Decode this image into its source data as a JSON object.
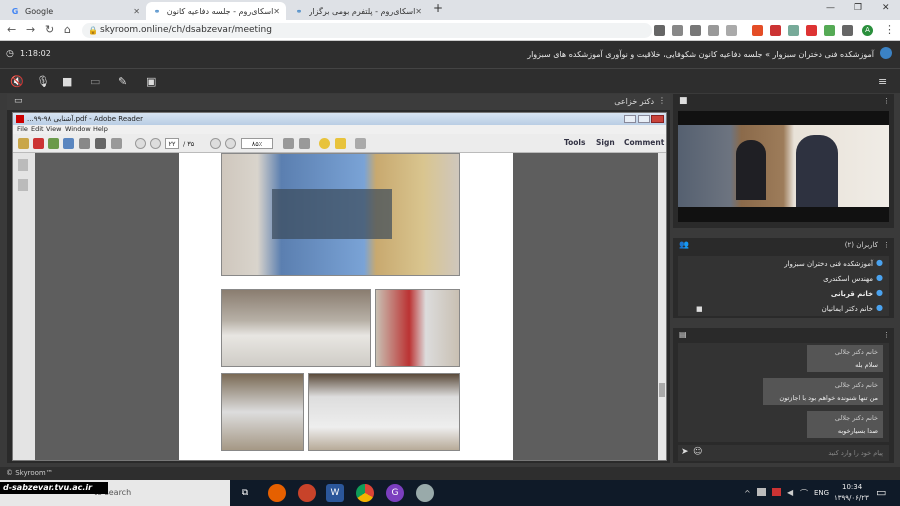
{
  "browser": {
    "tabs": [
      {
        "title": "Google",
        "active": false
      },
      {
        "title": "اسکای‌روم - جلسه دفاعیه کانون ش…",
        "active": true
      },
      {
        "title": "اسکای‌روم - پلتفرم بومی برگزاری و…",
        "active": false
      }
    ],
    "new_tab": "+",
    "url": "skyroom.online/ch/dsabzevar/meeting",
    "profile_initial": "A"
  },
  "app": {
    "timer": "1:18:02",
    "title": "آموزشکده فنی دختران سبزوار » جلسه دفاعیه کانون شکوفایی، خلاقیت و نوآوری آموزشکده های سبزوار",
    "presenter": "دکتر خزاعی"
  },
  "reader": {
    "title": "...آشنایی ۹۸-۹۹.pdf - Adobe Reader",
    "menu": [
      "File",
      "Edit",
      "View",
      "Window",
      "Help"
    ],
    "page_num": "۲۲",
    "page_sep": "/ ۳۵",
    "zoom": "۸۵٪",
    "right_tools": [
      "Tools",
      "Sign",
      "Comment"
    ]
  },
  "users": {
    "header": "کاربران (۲)",
    "list": [
      {
        "name": "آموزشکده فنی دختران سبزوار",
        "bold": false
      },
      {
        "name": "مهندس اسکندری",
        "bold": false
      },
      {
        "name": "خانم قربانی",
        "bold": true
      },
      {
        "name": "خانم دکتر ایمانیان",
        "bold": false
      }
    ]
  },
  "chat": {
    "messages": [
      {
        "sender": "خانم دکتر جلالی",
        "text": "سلام بله"
      },
      {
        "sender": "خانم دکتر جلالی",
        "text": "من تنها شنونده خواهم بود با اجازتون"
      },
      {
        "sender": "خانم دکتر جلالی",
        "text": "صدا بسیارخوبه"
      }
    ],
    "placeholder": "پیام خود را وارد کنید"
  },
  "footer": {
    "brand": "© Skyroom™"
  },
  "taskbar": {
    "watermark": "d-sabzevar.tvu.ac.ir",
    "search_text": "to search",
    "lang": "ENG",
    "time": "10:34",
    "date": "۱۳۹۹/۰۶/۲۳"
  },
  "colors": {
    "accent_blue": "#4aa3f0",
    "panel_dark": "#2a2a2a",
    "header_dark": "#2e2e2e"
  }
}
